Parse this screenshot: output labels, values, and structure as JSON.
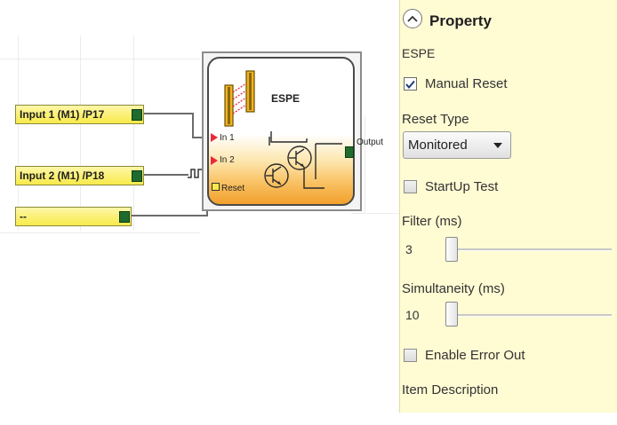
{
  "canvas": {
    "inputs": [
      {
        "label": "Input 1 (M1) /P17"
      },
      {
        "label": "Input 2 (M1) /P18"
      },
      {
        "label": "--"
      }
    ],
    "espe_block": {
      "title": "ESPE",
      "pins": [
        "In 1",
        "In 2",
        "Reset"
      ],
      "output_label": "Output"
    }
  },
  "panel": {
    "title": "Property",
    "object_name": "ESPE",
    "manual_reset": {
      "label": "Manual Reset",
      "checked": true
    },
    "reset_type": {
      "label": "Reset Type",
      "value": "Monitored"
    },
    "startup_test": {
      "label": "StartUp Test",
      "checked": false
    },
    "filter": {
      "label": "Filter (ms)",
      "value": "3",
      "fraction": 0.0
    },
    "simultaneity": {
      "label": "Simultaneity (ms)",
      "value": "10",
      "fraction": 0.0
    },
    "enable_error_out": {
      "label": "Enable Error Out",
      "checked": false
    },
    "item_description": {
      "label": "Item Description"
    }
  },
  "colors": {
    "panel_bg": "#fffbd3",
    "input_block_yellow": "#f7ea4a",
    "port_green": "#1f6b2e",
    "pin_red": "#e8293a",
    "espe_orange": "#f2a02c"
  },
  "icons": [
    "collapse-up-icon",
    "light-curtain-icon",
    "transistor-icon",
    "signal-pulse-icon",
    "check-icon",
    "dropdown-arrow-icon"
  ]
}
